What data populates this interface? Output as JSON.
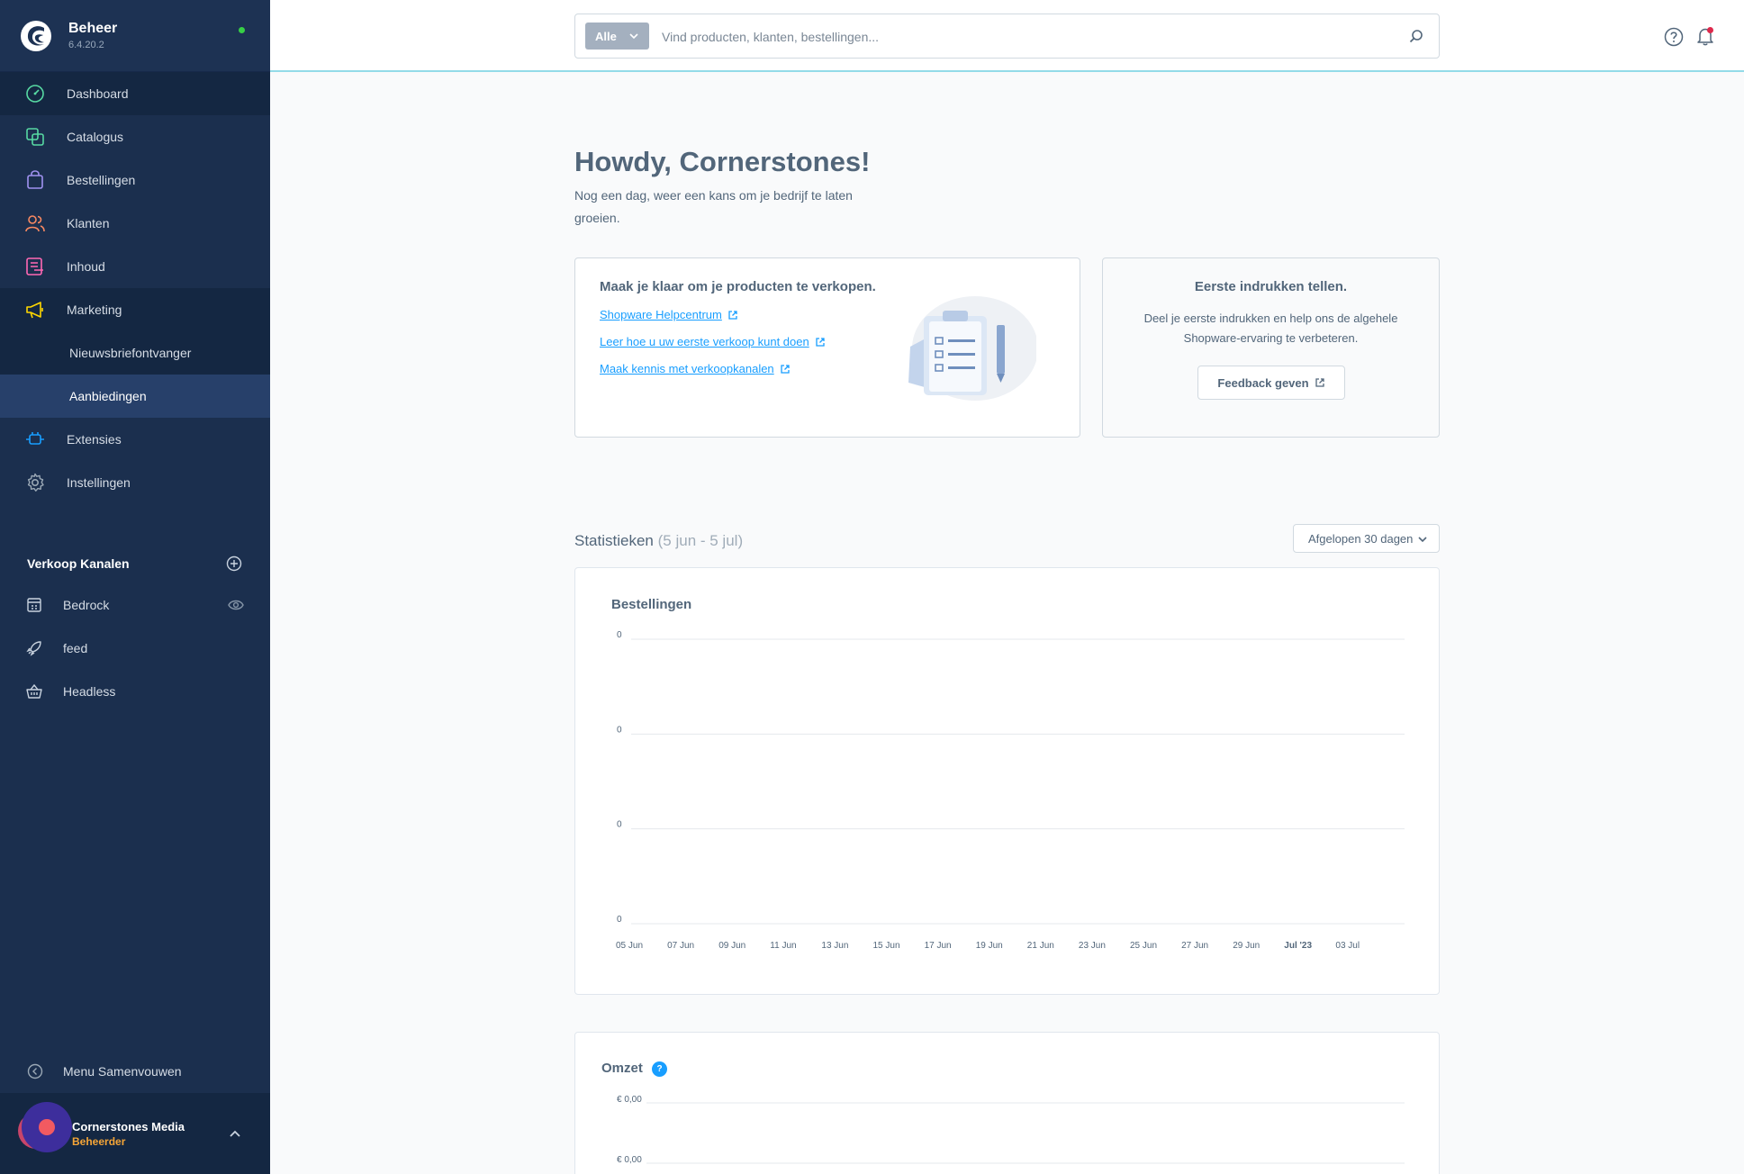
{
  "brand": {
    "title": "Beheer",
    "version": "6.4.20.2"
  },
  "nav": {
    "items": [
      {
        "label": "Dashboard",
        "icon": "dashboard-icon",
        "color": "#57d9a3"
      },
      {
        "label": "Catalogus",
        "icon": "catalog-icon",
        "color": "#57d9a3"
      },
      {
        "label": "Bestellingen",
        "icon": "orders-icon",
        "color": "#a092f0"
      },
      {
        "label": "Klanten",
        "icon": "customers-icon",
        "color": "#f88962"
      },
      {
        "label": "Inhoud",
        "icon": "content-icon",
        "color": "#ff68b4"
      },
      {
        "label": "Marketing",
        "icon": "marketing-icon",
        "color": "#ffd700"
      },
      {
        "label": "Extensies",
        "icon": "extensions-icon",
        "color": "#189eff"
      },
      {
        "label": "Instellingen",
        "icon": "settings-icon",
        "color": "#9aa8b5"
      }
    ],
    "marketing_sub": [
      "Nieuwsbriefontvanger",
      "Aanbiedingen"
    ]
  },
  "sales_channels": {
    "title": "Verkoop Kanalen",
    "items": [
      {
        "label": "Bedrock",
        "icon": "storefront-icon"
      },
      {
        "label": "feed",
        "icon": "rocket-icon"
      },
      {
        "label": "Headless",
        "icon": "basket-icon"
      }
    ]
  },
  "collapse_label": "Menu Samenvouwen",
  "user": {
    "name": "Cornerstones Media",
    "role": "Beheerder"
  },
  "search": {
    "scope": "Alle",
    "placeholder": "Vind producten, klanten, bestellingen..."
  },
  "greeting": {
    "title": "Howdy, Cornerstones!",
    "subtitle": "Nog een dag, weer een kans om je bedrijf te laten groeien."
  },
  "card_sell": {
    "title": "Maak je klaar om je producten te verkopen.",
    "links": [
      "Shopware Helpcentrum",
      "Leer hoe u uw eerste verkoop kunt doen",
      "Maak kennis met verkoopkanalen"
    ]
  },
  "card_feedback": {
    "title": "Eerste indrukken tellen.",
    "text": "Deel je eerste indrukken en help ons de algehele Shopware-ervaring te verbeteren.",
    "button": "Feedback geven"
  },
  "stats": {
    "title": "Statistieken",
    "range": "(5 jun - 5 jul)",
    "select": "Afgelopen 30 dagen"
  },
  "orders_chart": {
    "title": "Bestellingen",
    "y_ticks": [
      "0",
      "0",
      "0",
      "0"
    ],
    "x_ticks": [
      "05 Jun",
      "07 Jun",
      "09 Jun",
      "11 Jun",
      "13 Jun",
      "15 Jun",
      "17 Jun",
      "19 Jun",
      "21 Jun",
      "23 Jun",
      "25 Jun",
      "27 Jun",
      "29 Jun",
      "Jul '23",
      "03 Jul"
    ]
  },
  "revenue_chart": {
    "title": "Omzet",
    "help": "?",
    "y_ticks": [
      "€ 0,00",
      "€ 0,00"
    ]
  },
  "colors": {
    "sidebar": "#1b2f4e",
    "accent": "#189eff",
    "online": "#37d046"
  }
}
